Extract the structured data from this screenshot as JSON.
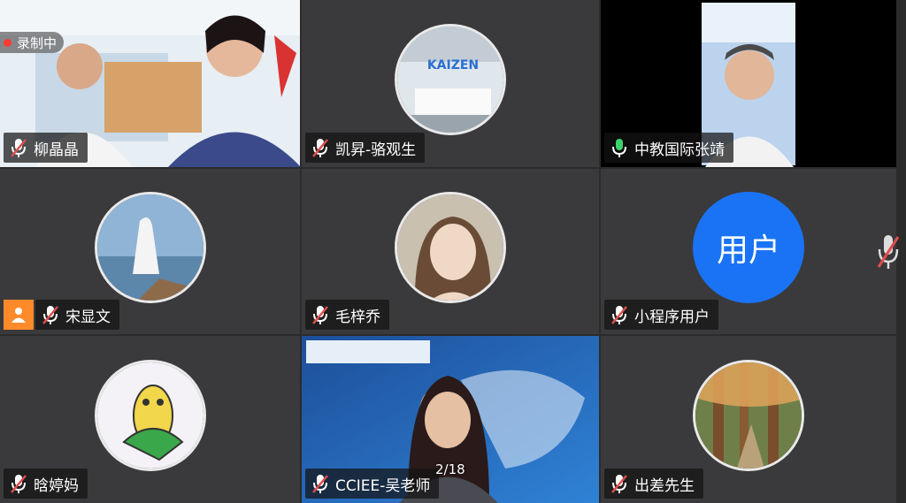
{
  "recording": {
    "label": "录制中"
  },
  "pagination": {
    "text": "2/18"
  },
  "tiles": [
    {
      "name": "柳晶晶",
      "mic": "muted"
    },
    {
      "name": "凯昇-骆观生",
      "mic": "muted"
    },
    {
      "name": "中教国际张靖",
      "mic": "speaking"
    },
    {
      "name": "宋显文",
      "mic": "muted"
    },
    {
      "name": "毛梓乔",
      "mic": "muted"
    },
    {
      "name": "小程序用户",
      "mic": "muted",
      "avatar_text": "用户"
    },
    {
      "name": "晗婷妈",
      "mic": "muted"
    },
    {
      "name": "CCIEE-吴老师",
      "mic": "muted"
    },
    {
      "name": "出差先生",
      "mic": "muted"
    }
  ],
  "colors": {
    "active_border": "#3cd36a",
    "muted_mic": "#e14d4d",
    "speaking_mic": "#3cd36a",
    "avatar_blue": "#1a73f5"
  },
  "icons": {
    "muted": "mic-off-icon",
    "speaking": "mic-on-icon"
  }
}
